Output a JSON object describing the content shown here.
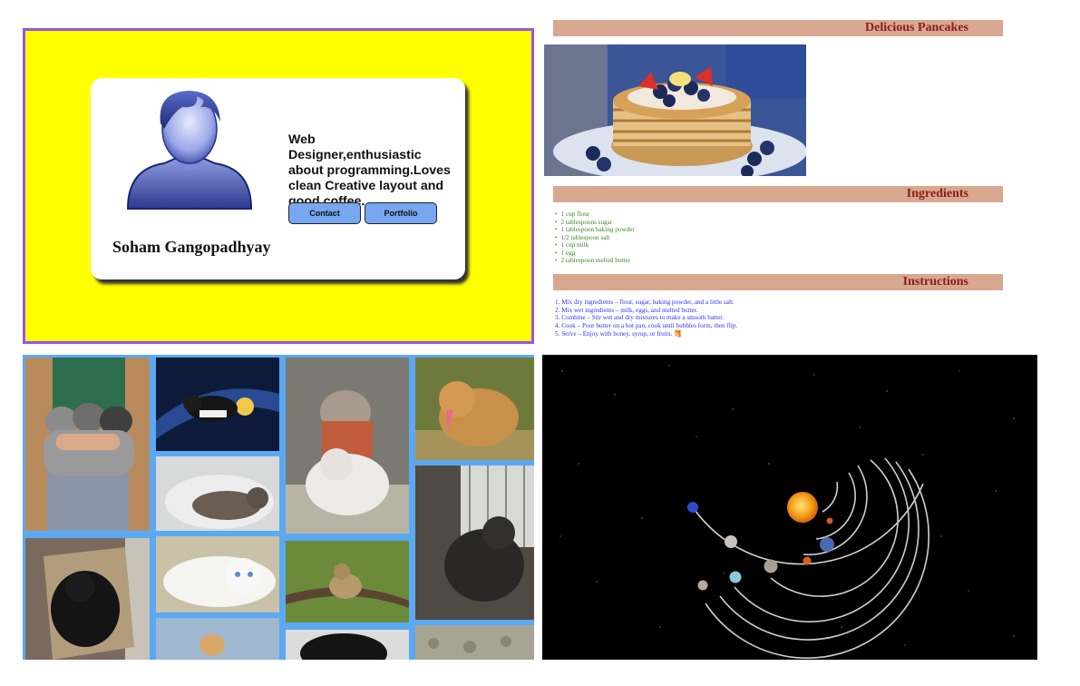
{
  "profile_card": {
    "name": "Soham Gangopadhyay",
    "bio": "Web Designer,enthusiastic about programming.Loves clean Creative layout and good coffee.",
    "contact_label": "Contact",
    "portfolio_label": "Portfolio",
    "colors": {
      "panel_background": "#ffff00",
      "panel_border": "#9b51e8",
      "button": "#76a7f0"
    }
  },
  "recipe": {
    "title": "Delicious Pancakes",
    "ingredients_heading": "Ingredients",
    "ingredients": [
      "1 cup flour",
      "2 tablespoons sugar",
      "1 tablespoon baking powder",
      "1/2 tablespoon salt",
      "1 cup milk",
      "1 egg",
      "2 tablespoon melted butter"
    ],
    "instructions_heading": "Instructions",
    "instructions": [
      "1. Mix dry ingredients – flour, sugar, baking powder, and a little salt.",
      "2. Mix wet ingredients – milk, eggs, and melted butter.",
      "3. Combine – Stir wet and dry mixtures to make a smooth batter.",
      "4. Cook – Pour butter on a hot pan, cook until bubbles form, then flip.",
      "5. Serve – Enjoy with honey, syrup, or fruits. 🥞"
    ],
    "colors": {
      "heading_bar": "#d8a790",
      "heading_text": "#8b1d1d",
      "ingredients_text": "#3a8a28",
      "instructions_text": "#3232ff"
    }
  },
  "gallery": {
    "background": "#5aa9f2",
    "photos": [
      "kittens-held-photo",
      "cat-space-photo",
      "cat-sink-photo",
      "white-cat-photo",
      "black-cat-box-photo",
      "cats-sweater-photo",
      "bengal-cat-photo",
      "dog-tongue-photo",
      "dog-window-photo",
      "cat-bottom-photo",
      "dog-bottom-photo",
      "cat-rocks-photo"
    ]
  },
  "solar_system": {
    "background": "#000000",
    "bodies": [
      "sun",
      "mercury",
      "venus",
      "earth",
      "mars",
      "jupiter",
      "saturn",
      "uranus",
      "neptune"
    ]
  }
}
